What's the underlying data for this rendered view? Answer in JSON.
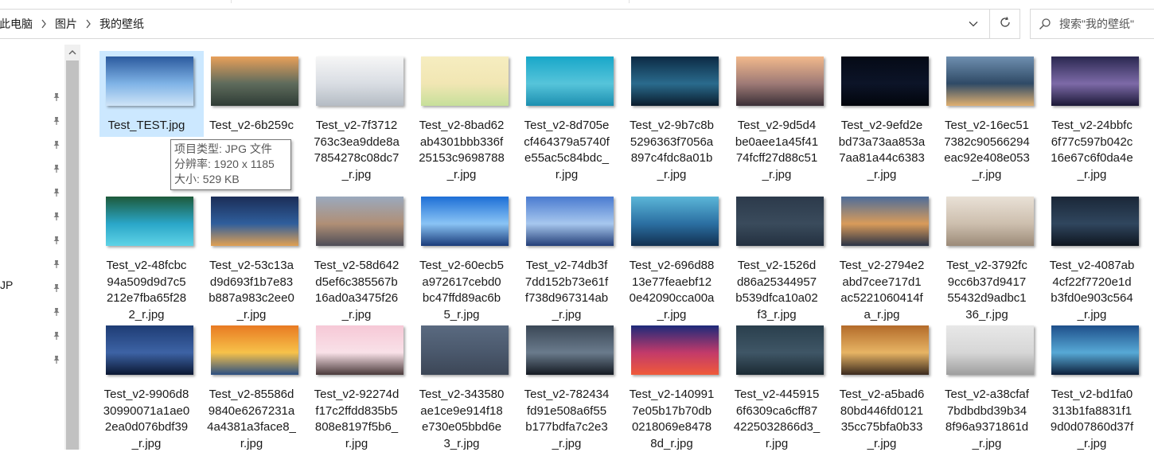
{
  "breadcrumb": {
    "items": [
      "此电脑",
      "图片",
      "我的壁纸"
    ]
  },
  "search": {
    "placeholder": "搜索\"我的壁纸\""
  },
  "nav": {
    "partial_label": "JP",
    "pin_count": 12
  },
  "tooltip": {
    "type_line": "项目类型: JPG 文件",
    "resolution_line": "分辨率: 1920 x 1185",
    "size_line": "大小: 529 KB"
  },
  "files": [
    {
      "name": "Test_TEST.jpg",
      "lines": [
        "Test_TEST.jpg"
      ],
      "colors": [
        "#2b5a9e",
        "#7fb3e6",
        "#cfe4f7"
      ],
      "selected": true
    },
    {
      "name": "Test_v2-6b259c…",
      "lines": [
        "Test_v2-6b259c",
        "…",
        "_r"
      ],
      "colors": [
        "#e8a05a",
        "#5e6b5c",
        "#2f3c35"
      ]
    },
    {
      "name": "Test_v2-7f3712763c3ea9dde8a7854278c08dc7_r.jpg",
      "lines": [
        "Test_v2-7f3712",
        "763c3ea9dde8a",
        "7854278c08dc7",
        "_r.jpg"
      ],
      "colors": [
        "#f6f6f6",
        "#d9dde3",
        "#b5bcc4"
      ]
    },
    {
      "name": "Test_v2-8bad62ab4301bbb336f25153c9698788_r.jpg",
      "lines": [
        "Test_v2-8bad62",
        "ab4301bbb336f",
        "25153c9698788",
        "_r.jpg"
      ],
      "colors": [
        "#f6edc0",
        "#f1e6b3",
        "#c6df9a"
      ]
    },
    {
      "name": "Test_v2-8d705ecf464379a5740fe55ac5c84bdc_r.jpg",
      "lines": [
        "Test_v2-8d705e",
        "cf464379a5740f",
        "e55ac5c84bdc_",
        "r.jpg"
      ],
      "colors": [
        "#18a7c9",
        "#56c4da",
        "#1c8fb0"
      ]
    },
    {
      "name": "Test_v2-9b7c8b5296363f7056a897c4fdc8a01b_r.jpg",
      "lines": [
        "Test_v2-9b7c8b",
        "5296363f7056a",
        "897c4fdc8a01b",
        "_r.jpg"
      ],
      "colors": [
        "#0c2a44",
        "#2a6b8d",
        "#0a1c2c"
      ]
    },
    {
      "name": "Test_v2-9d5d4be0aee1a45f4174fcff27d88c51_r.jpg",
      "lines": [
        "Test_v2-9d5d4",
        "be0aee1a45f41",
        "74fcff27d88c51",
        "_r.jpg"
      ],
      "colors": [
        "#f2b98c",
        "#9e7a76",
        "#3a2f36"
      ]
    },
    {
      "name": "Test_v2-9efd2ebd73a73aa853a7aa81a44c6383_r.jpg",
      "lines": [
        "Test_v2-9efd2e",
        "bd73a73aa853a",
        "7aa81a44c6383",
        "_r.jpg"
      ],
      "colors": [
        "#050a16",
        "#0c1428",
        "#02050c"
      ]
    },
    {
      "name": "Test_v2-16ec517382c90566294eac92e408e053_r.jpg",
      "lines": [
        "Test_v2-16ec51",
        "7382c90566294",
        "eac92e408e053",
        "_r.jpg"
      ],
      "colors": [
        "#6f8fb0",
        "#2f4a66",
        "#e0b070"
      ]
    },
    {
      "name": "Test_v2-24bbfc6f77c597b042c16e67c6f0da4e_r.jpg",
      "lines": [
        "Test_v2-24bbfc",
        "6f77c597b042c",
        "16e67c6f0da4e",
        "_r.jpg"
      ],
      "colors": [
        "#2a2850",
        "#7d6aa8",
        "#1b1836"
      ]
    },
    {
      "name": "Test_v2-48fcbc94a509d9d7c5212e7fba65f282_r.jpg",
      "lines": [
        "Test_v2-48fcbc",
        "94a509d9d7c5",
        "212e7fba65f28",
        "2_r.jpg"
      ],
      "colors": [
        "#1d5a3a",
        "#2aa6c8",
        "#5fd3e6"
      ]
    },
    {
      "name": "Test_v2-53c13ad9d693f1b7e83b887a983c2ee0_r.jpg",
      "lines": [
        "Test_v2-53c13a",
        "d9d693f1b7e83",
        "b887a983c2ee0",
        "_r.jpg"
      ],
      "colors": [
        "#1b2d57",
        "#2f5e9c",
        "#e0a052"
      ]
    },
    {
      "name": "Test_v2-58d642d5ef6c385567b16ad0a3475f26_r.jpg",
      "lines": [
        "Test_v2-58d642",
        "d5ef6c385567b",
        "16ad0a3475f26",
        "_r.jpg"
      ],
      "colors": [
        "#9aa9bd",
        "#b08f76",
        "#4e4d57"
      ]
    },
    {
      "name": "Test_v2-60ecb5a972617cebd0bc47ffd89ac6b5_r.jpg",
      "lines": [
        "Test_v2-60ecb5",
        "a972617cebd0",
        "bc47ffd89ac6b",
        "5_r.jpg"
      ],
      "colors": [
        "#1d6fd6",
        "#8ac4f5",
        "#1a3b7a"
      ]
    },
    {
      "name": "Test_v2-74db3f7dd152b73e61ff738d967314ab_r.jpg",
      "lines": [
        "Test_v2-74db3f",
        "7dd152b73e61f",
        "f738d967314ab",
        "_r.jpg"
      ],
      "colors": [
        "#4a7bd0",
        "#a7c7ee",
        "#233e78"
      ]
    },
    {
      "name": "Test_v2-696d8813e77feaebf120e42090cca00a_r.jpg",
      "lines": [
        "Test_v2-696d88",
        "13e77feaebf12",
        "0e42090cca00a",
        "_r.jpg"
      ],
      "colors": [
        "#5bb6d8",
        "#2b6fa2",
        "#123050"
      ]
    },
    {
      "name": "Test_v2-1526dd86a25344957b539dfca10a02f3_r.jpg",
      "lines": [
        "Test_v2-1526d",
        "d86a25344957",
        "b539dfca10a02",
        "f3_r.jpg"
      ],
      "colors": [
        "#2c3a4b",
        "#3a4b5c",
        "#233040"
      ]
    },
    {
      "name": "Test_v2-2794e2abd7cee717d1ac5221060414fa_r.jpg",
      "lines": [
        "Test_v2-2794e2",
        "abd7cee717d1",
        "ac5221060414f",
        "a_r.jpg"
      ],
      "colors": [
        "#4d6d9a",
        "#d99b5a",
        "#2a3346"
      ]
    },
    {
      "name": "Test_v2-3792fc9cc6b37d941755432d9adbc136_r.jpg",
      "lines": [
        "Test_v2-3792fc",
        "9cc6b37d9417",
        "55432d9adbc1",
        "36_r.jpg"
      ],
      "colors": [
        "#e9e1d6",
        "#cdbfae",
        "#9b8a78"
      ]
    },
    {
      "name": "Test_v2-4087ab4cf22f7720e1db3fd0e903c564_r.jpg",
      "lines": [
        "Test_v2-4087ab",
        "4cf22f7720e1d",
        "b3fd0e903c564",
        "_r.jpg"
      ],
      "colors": [
        "#1a2738",
        "#30465e",
        "#0e151f"
      ]
    },
    {
      "name": "Test_v2-9906d830990071a1ae02ea0d076bdf39_r.jpg",
      "lines": [
        "Test_v2-9906d8",
        "30990071a1ae0",
        "2ea0d076bdf39",
        "_r.jpg"
      ],
      "colors": [
        "#1e3c74",
        "#3d63a5",
        "#0b1732"
      ]
    },
    {
      "name": "Test_v2-85586d9840e6267231a4a4381a3face8_r.jpg",
      "lines": [
        "Test_v2-85586d",
        "9840e6267231a",
        "4a4381a3face8_",
        "r.jpg"
      ],
      "colors": [
        "#e87a22",
        "#f7c24a",
        "#2b4f82"
      ]
    },
    {
      "name": "Test_v2-92274df17c2ffdd835b5808e8197f5b6_r.jpg",
      "lines": [
        "Test_v2-92274d",
        "f17c2ffdd835b5",
        "808e8197f5b6_",
        "r.jpg"
      ],
      "colors": [
        "#f6c8d6",
        "#f9e1e8",
        "#4a3a3a"
      ]
    },
    {
      "name": "Test_v2-343580ae1ce9e914f18e730e05bbd6e3_r.jpg",
      "lines": [
        "Test_v2-343580",
        "ae1ce9e914f18",
        "e730e05bbd6e",
        "3_r.jpg"
      ],
      "colors": [
        "#5a6a80",
        "#4a586c",
        "#3c4656"
      ]
    },
    {
      "name": "Test_v2-782434fd91e508a6f55b177bdfa7c2e3_r.jpg",
      "lines": [
        "Test_v2-782434",
        "fd91e508a6f55",
        "b177bdfa7c2e3",
        "_r.jpg"
      ],
      "colors": [
        "#3a4756",
        "#6a7b8c",
        "#141a22"
      ]
    },
    {
      "name": "Test_v2-1409917e05b17b70db0218069e84788d_r.jpg",
      "lines": [
        "Test_v2-140991",
        "7e05b17b70db",
        "0218069e8478",
        "8d_r.jpg"
      ],
      "colors": [
        "#1d2a7a",
        "#c23a6a",
        "#f05a3a"
      ]
    },
    {
      "name": "Test_v2-4459156f6309ca6cff874225032866d3_r.jpg",
      "lines": [
        "Test_v2-445915",
        "6f6309ca6cff87",
        "4225032866d3_",
        "r.jpg"
      ],
      "colors": [
        "#2a3f4d",
        "#3f5666",
        "#1b2a33"
      ]
    },
    {
      "name": "Test_v2-a5bad680bd446fd012135cc75bfa0b33_r.jpg",
      "lines": [
        "Test_v2-a5bad6",
        "80bd446fd0121",
        "35cc75bfa0b33",
        "_r.jpg"
      ],
      "colors": [
        "#b36b2a",
        "#e7b464",
        "#3a2a1e"
      ]
    },
    {
      "name": "Test_v2-a38cfaf7bdbdbd39b348f96a9371861d_r.jpg",
      "lines": [
        "Test_v2-a38cfaf",
        "7bdbdbd39b34",
        "8f96a9371861d",
        "_r.jpg"
      ],
      "colors": [
        "#e8e8e8",
        "#d6d6d6",
        "#9e9e9e"
      ]
    },
    {
      "name": "Test_v2-bd1fa0313b1fa8831f19d0d07860d37f_r.jpg",
      "lines": [
        "Test_v2-bd1fa0",
        "313b1fa8831f1",
        "9d0d07860d37f",
        "_r.jpg"
      ],
      "colors": [
        "#1e4f8a",
        "#57a9d6",
        "#0c1f3a"
      ]
    }
  ]
}
